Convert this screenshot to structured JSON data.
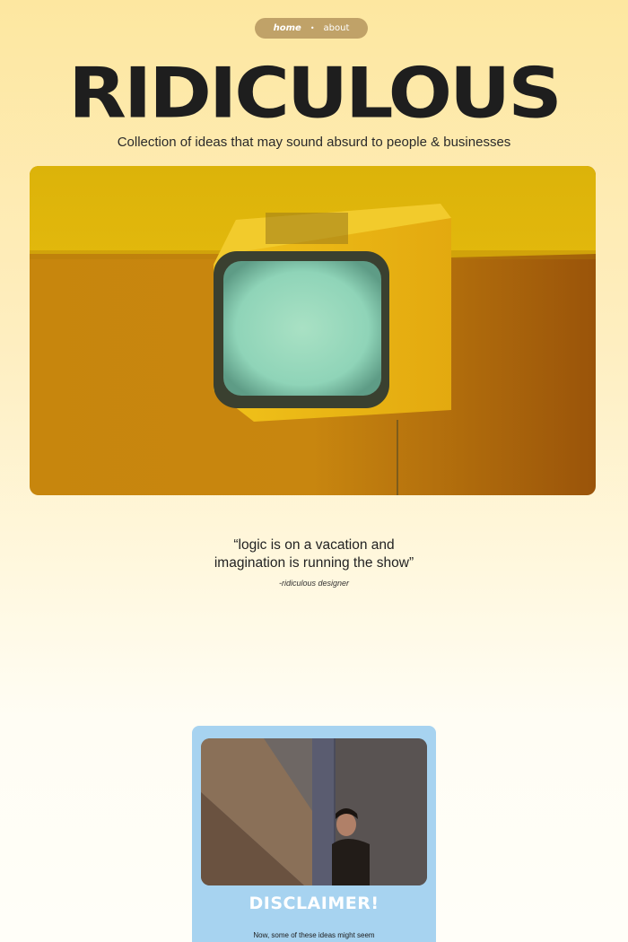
{
  "nav": {
    "home_label": "home",
    "separator": "•",
    "about_label": "about"
  },
  "header": {
    "title": "RIDICULOUS",
    "subtitle": "Collection of ideas that may sound absurd to people & businesses"
  },
  "hero": {
    "image": "retro-tv-on-yellow-wall-photo"
  },
  "quote": {
    "line1": "“logic is on a vacation and",
    "line2": "imagination is running the show”",
    "author": "-ridiculous designer"
  },
  "disclaimer": {
    "image": "man-peeking-behind-wall-photo",
    "heading": "DISCLAIMER!",
    "text": "Now, some of these ideas might seem"
  },
  "colors": {
    "background_top": "#fde7a0",
    "background_bottom": "#fffef8",
    "nav_pill": "#c0a268",
    "title": "#1e1e1e",
    "card": "#a7d3f0"
  }
}
